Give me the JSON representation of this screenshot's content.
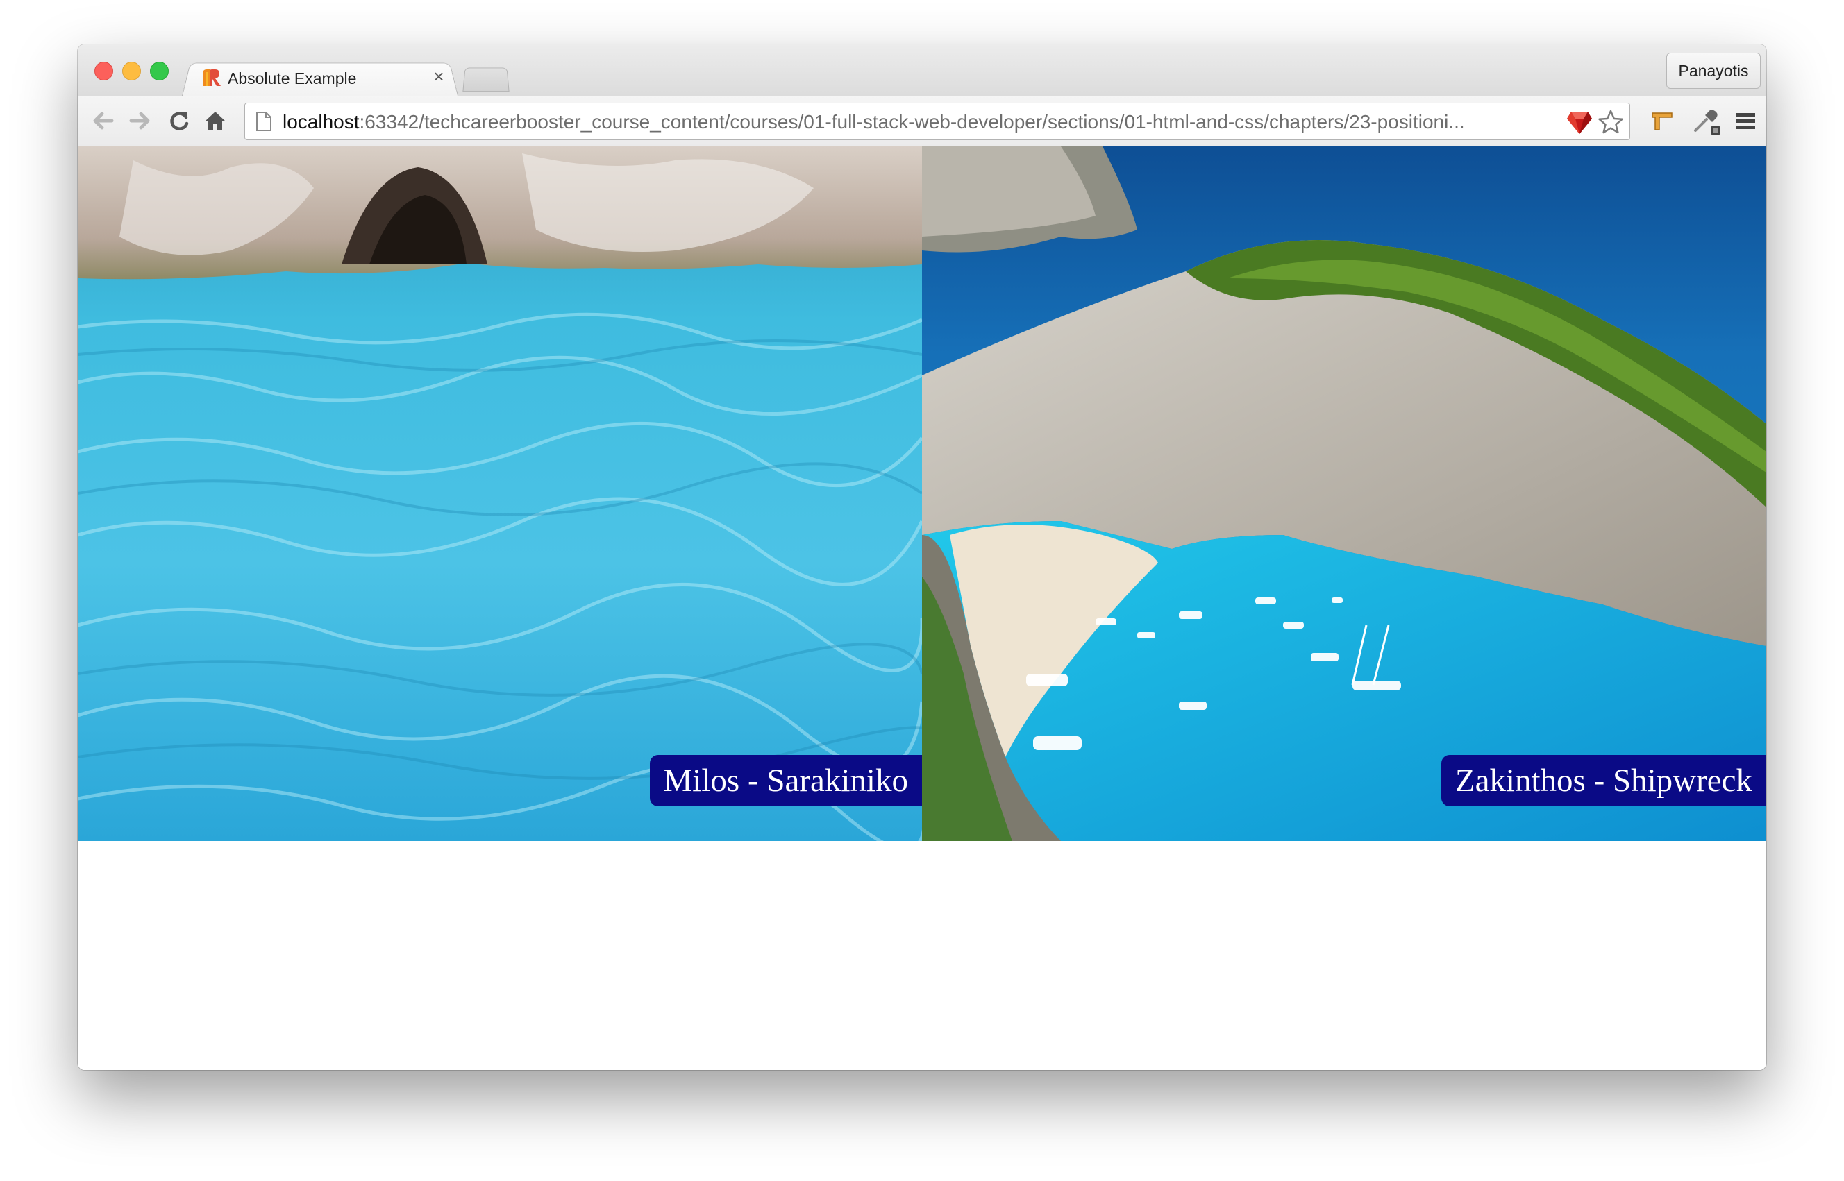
{
  "window": {
    "tab_title": "Absolute Example",
    "tab_close": "×",
    "profile_name": "Panayotis"
  },
  "toolbar": {
    "url_host": "localhost",
    "url_rest": ":63342/techcareerbooster_course_content/courses/01-full-stack-web-developer/sections/01-html-and-css/chapters/23-positioni..."
  },
  "icons": {
    "back": "back-arrow-icon",
    "forward": "forward-arrow-icon",
    "reload": "reload-icon",
    "home": "home-icon",
    "page": "page-icon",
    "ruby": "ruby-gem-icon",
    "star": "bookmark-star-icon",
    "extension": "extension-icon",
    "eyedropper": "eyedropper-icon",
    "menu": "hamburger-menu-icon"
  },
  "photos": [
    {
      "caption": "Milos - Sarakiniko"
    },
    {
      "caption": "Zakinthos - Shipwreck"
    }
  ],
  "colors": {
    "caption_bg": "#0a0a86",
    "caption_text": "#ffffff"
  }
}
